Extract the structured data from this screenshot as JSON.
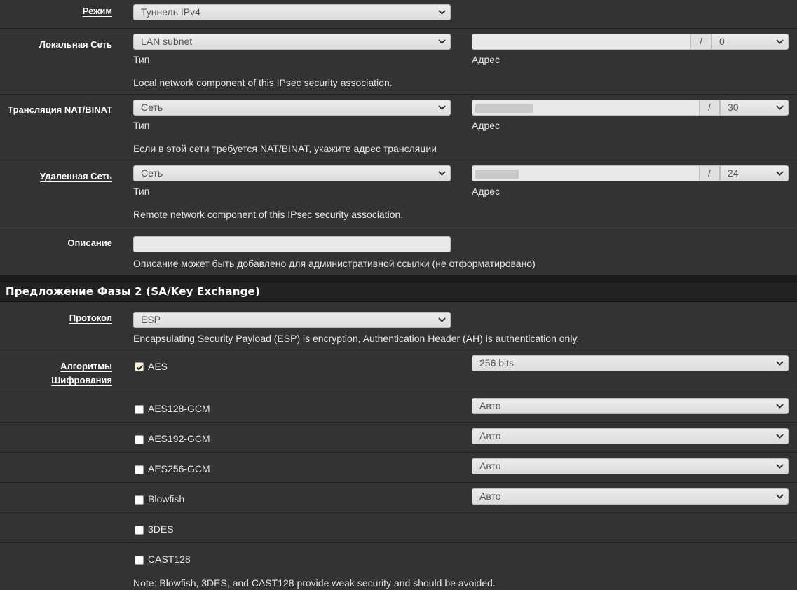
{
  "mode": {
    "label": "Режим",
    "value": "Туннель IPv4"
  },
  "local_network": {
    "label": "Локальная Сеть",
    "type_value": "LAN subnet",
    "type_caption": "Тип",
    "address_value": "",
    "address_caption": "Адрес",
    "slash": "/",
    "mask_value": "0",
    "help": "Local network component of this IPsec security association."
  },
  "nat": {
    "label": "Трансляция NAT/BINAT",
    "type_value": "Сеть",
    "type_caption": "Тип",
    "address_caption": "Адрес",
    "slash": "/",
    "mask_value": "30",
    "help": "Если в этой сети требуется NAT/BINAT, укажите адрес трансляции"
  },
  "remote_network": {
    "label": "Удаленная Сеть",
    "type_value": "Сеть",
    "type_caption": "Тип",
    "address_caption": "Адрес",
    "slash": "/",
    "mask_value": "24",
    "help": "Remote network component of this IPsec security association."
  },
  "description": {
    "label": "Описание",
    "value": "",
    "help": "Описание может быть добавлено для административной ссылки (не отформатировано)"
  },
  "phase2": {
    "section_title": "Предложение Фазы 2 (SA/Key Exchange)",
    "protocol": {
      "label": "Протокол",
      "value": "ESP",
      "help": "Encapsulating Security Payload (ESP) is encryption, Authentication Header (AH) is authentication only."
    },
    "encryption": {
      "label_line1": "Алгоритмы",
      "label_line2": "Шифрования",
      "algorithms": [
        {
          "name": "AES",
          "checked": true,
          "keylen": "256 bits"
        },
        {
          "name": "AES128-GCM",
          "checked": false,
          "keylen": "Авто"
        },
        {
          "name": "AES192-GCM",
          "checked": false,
          "keylen": "Авто"
        },
        {
          "name": "AES256-GCM",
          "checked": false,
          "keylen": "Авто"
        },
        {
          "name": "Blowfish",
          "checked": false,
          "keylen": "Авто"
        },
        {
          "name": "3DES",
          "checked": false
        },
        {
          "name": "CAST128",
          "checked": false
        }
      ],
      "note": "Note: Blowfish, 3DES, and CAST128 provide weak security and should be avoided."
    }
  },
  "colors": {
    "background": "#333333",
    "section_header": "#222222",
    "control_bg": "#e9e9e9",
    "text": "#e6e6e6"
  }
}
